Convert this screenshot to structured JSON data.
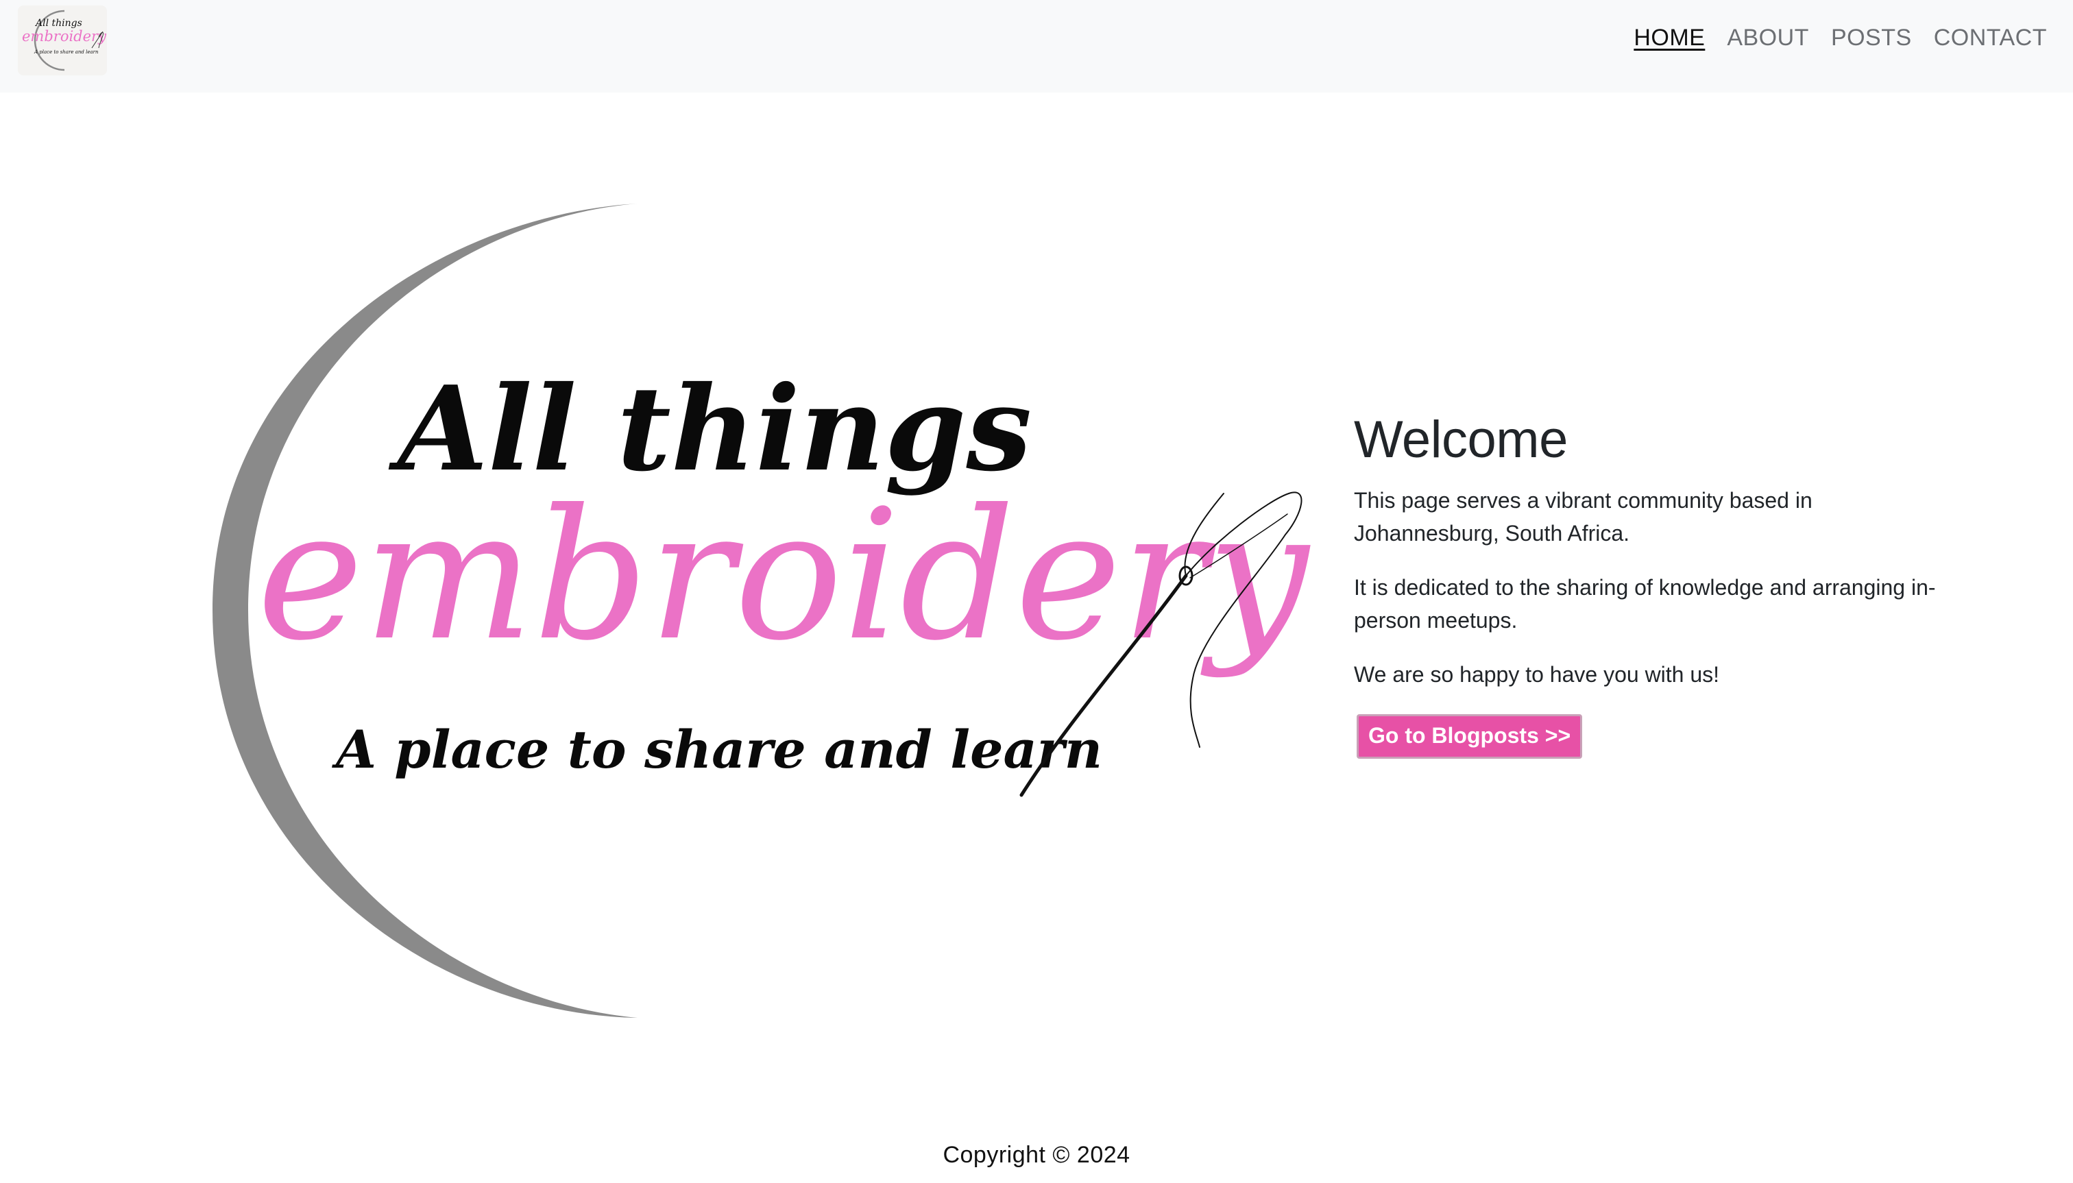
{
  "brand": {
    "logo_icon": "all-things-embroidery-logo",
    "logo_text_top": "All things",
    "logo_text_main": "embroidery",
    "logo_text_sub": "A place to share and learn"
  },
  "nav": {
    "items": [
      {
        "label": "HOME",
        "active": true
      },
      {
        "label": "ABOUT",
        "active": false
      },
      {
        "label": "POSTS",
        "active": false
      },
      {
        "label": "CONTACT",
        "active": false
      }
    ]
  },
  "hero": {
    "logo_text_top": "All things",
    "logo_text_main": "embroidery",
    "logo_text_sub": "A place to share and learn",
    "logo_icon": "needle-and-thread-icon"
  },
  "welcome": {
    "title": "Welcome",
    "paragraphs": [
      "This page serves a vibrant community based in Johannesburg, South Africa.",
      "It is dedicated to the sharing of knowledge and arranging in-person meetups.",
      "We are so happy to have you with us!"
    ],
    "button_label": "Go to Blogposts >>"
  },
  "footer": {
    "copyright": "Copyright © 2024"
  },
  "colors": {
    "accent_pink": "#e751a6",
    "embroidery_pink": "#eb72c6",
    "navbar_bg": "#f8f9fa",
    "ring_gray": "#8a8a8a"
  }
}
